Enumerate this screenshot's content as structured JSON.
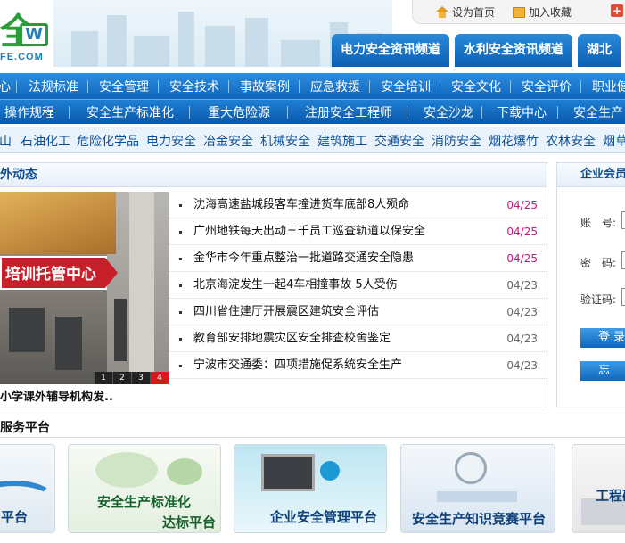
{
  "header": {
    "logo_mark": "全",
    "logo_w": "W",
    "logo_domain": "FE.COM",
    "toplinks": [
      {
        "label": "设为首页",
        "icon": "home-icon"
      },
      {
        "label": "加入收藏",
        "icon": "favorite-icon"
      },
      {
        "label": "",
        "icon": "plus-icon"
      }
    ],
    "channel_tabs": [
      "电力安全资讯频道",
      "水利安全资讯频道",
      "湖北"
    ]
  },
  "nav1": [
    "心",
    "法规标准",
    "安全管理",
    "安全技术",
    "事故案例",
    "应急救援",
    "安全培训",
    "安全文化",
    "安全评价",
    "职业健"
  ],
  "nav2": [
    "操作规程",
    "安全生产标准化",
    "重大危险源",
    "注册安全工程师",
    "安全沙龙",
    "下载中心",
    "安全生产"
  ],
  "categories": [
    "山",
    "石油化工",
    "危险化学品",
    "电力安全",
    "冶金安全",
    "机械安全",
    "建筑施工",
    "交通安全",
    "消防安全",
    "烟花爆竹",
    "农林安全",
    "烟草"
  ],
  "news": {
    "heading": "外动态",
    "photo_sign": "培训托管中心",
    "photo_caption": "小学课外辅导机构发..",
    "pager": [
      "1",
      "2",
      "3",
      "4"
    ],
    "items": [
      {
        "title": "沈海高速盐城段客车撞进货车底部8人殒命",
        "date": "04/25",
        "hot": true
      },
      {
        "title": "广州地铁每天出动三千员工巡查轨道以保安全",
        "date": "04/25",
        "hot": true
      },
      {
        "title": "金华市今年重点整治一批道路交通安全隐患",
        "date": "04/25",
        "hot": true
      },
      {
        "title": "北京海淀发生一起4车相撞事故 5人受伤",
        "date": "04/23",
        "hot": false
      },
      {
        "title": "四川省住建厅开展震区建筑安全评估",
        "date": "04/23",
        "hot": false
      },
      {
        "title": "教育部安排地震灾区安全排查校舍鉴定",
        "date": "04/23",
        "hot": false
      },
      {
        "title": "宁波市交通委：四项措施促系统安全生产",
        "date": "04/23",
        "hot": false
      }
    ],
    "hot_color": "#c2187a"
  },
  "member": {
    "heading": "企业会员",
    "account_label": "账　号:",
    "password_label": "密　码:",
    "captcha_label": "验证码:",
    "login_button": "登 录",
    "second_button": "忘"
  },
  "services": {
    "heading": "服务平台",
    "cards": [
      {
        "label": "平台"
      },
      {
        "label": "安全生产标准化",
        "sub": "达标平台"
      },
      {
        "label": "企业安全管理平台"
      },
      {
        "label": "安全生产知识竞赛平台"
      },
      {
        "label": "工程研"
      }
    ]
  },
  "colors": {
    "nav_blue": "#0f65bd",
    "accent_green": "#2d9b3a",
    "heading_blue": "#0b4a8c"
  }
}
